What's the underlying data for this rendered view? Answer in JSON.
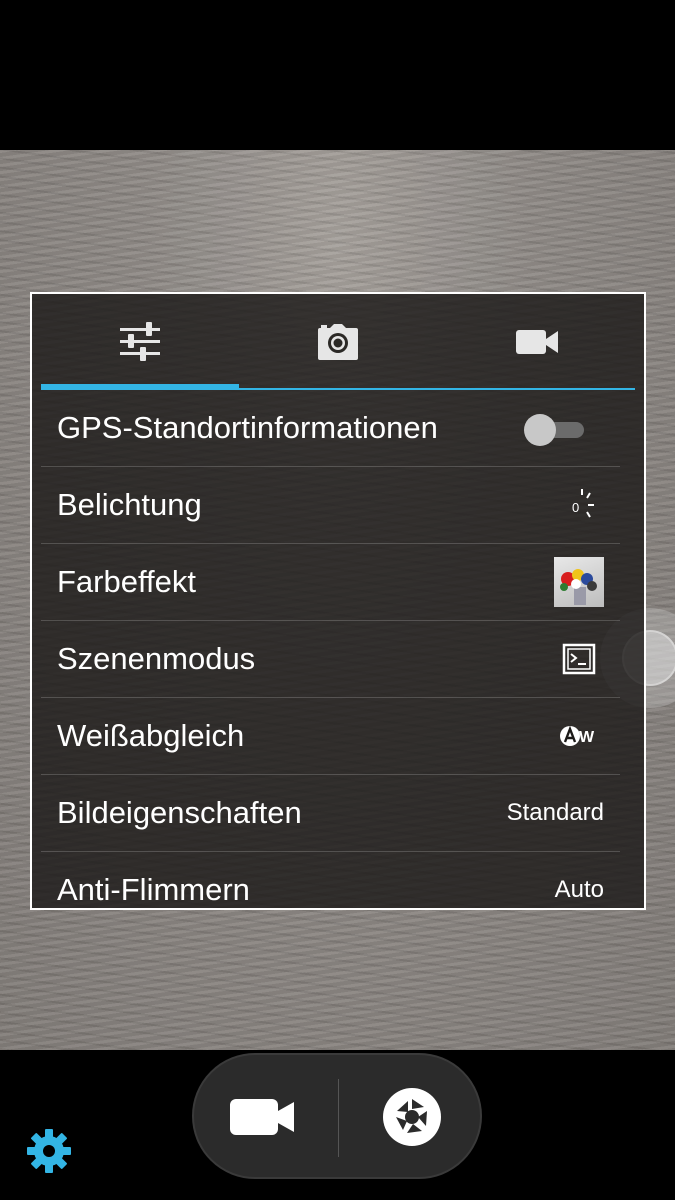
{
  "settings": {
    "tabs": [
      {
        "icon": "sliders-icon",
        "active": true
      },
      {
        "icon": "camera-icon",
        "active": false
      },
      {
        "icon": "video-camera-icon",
        "active": false
      }
    ],
    "rows": [
      {
        "label": "GPS-Standortinformationen",
        "control": "toggle",
        "on": false
      },
      {
        "label": "Belichtung",
        "control": "icon",
        "icon": "exposure-icon",
        "icon_text": "0"
      },
      {
        "label": "Farbeffekt",
        "control": "thumbnail",
        "icon": "color-effect-thumbnail"
      },
      {
        "label": "Szenenmodus",
        "control": "icon",
        "icon": "scene-mode-icon"
      },
      {
        "label": "Weißabgleich",
        "control": "icon",
        "icon": "white-balance-auto-icon",
        "icon_text": "W"
      },
      {
        "label": "Bildeigenschaften",
        "control": "text",
        "value": "Standard"
      },
      {
        "label": "Anti-Flimmern",
        "control": "text",
        "value": "Auto"
      }
    ]
  },
  "bottom": {
    "video_mode_icon": "video-camera-icon",
    "shutter_icon": "shutter-icon",
    "settings_icon": "gear-icon"
  },
  "colors": {
    "accent": "#33b5e5",
    "panel_border": "#ffffff"
  }
}
